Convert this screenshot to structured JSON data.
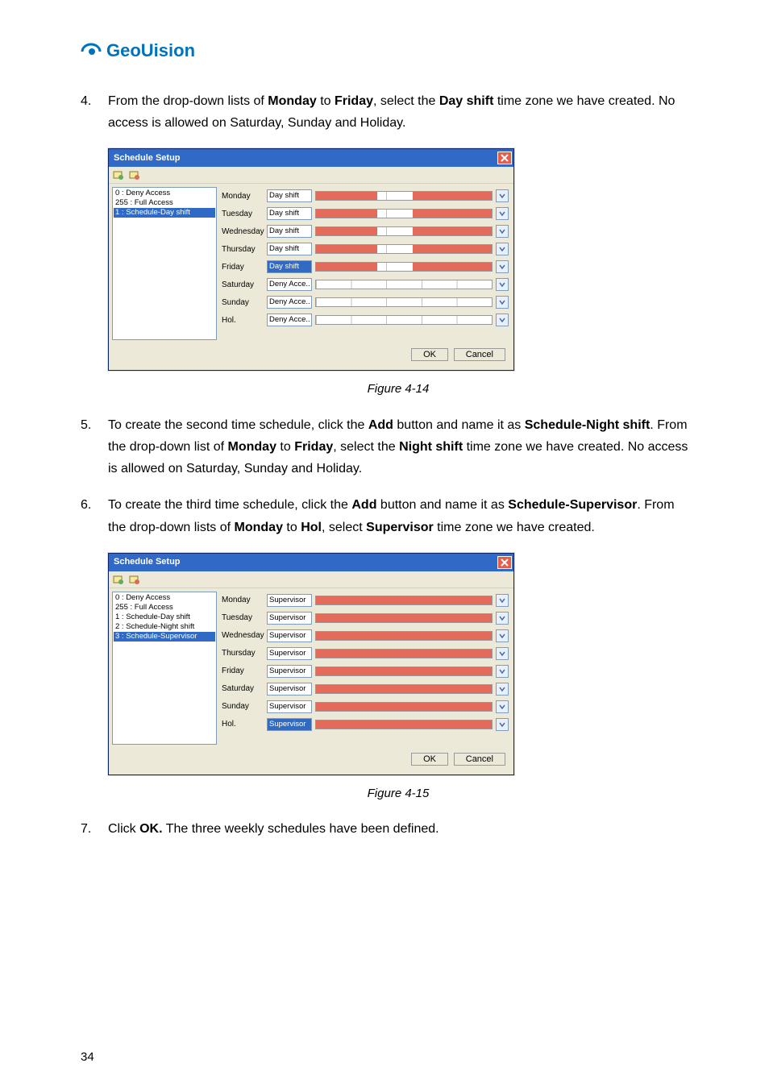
{
  "logo": {
    "text": "GeoUision"
  },
  "steps": [
    {
      "num": "4.",
      "html_parts": [
        "From the drop-down lists of ",
        {
          "b": "Monday"
        },
        " to ",
        {
          "b": "Friday"
        },
        ", select the ",
        {
          "b": "Day shift"
        },
        " time zone we have created. No access is allowed on Saturday, Sunday and Holiday."
      ]
    },
    {
      "num": "5.",
      "html_parts": [
        "To create the second time schedule, click the ",
        {
          "b": "Add"
        },
        " button and name it as ",
        {
          "b": "Schedule-Night shift"
        },
        ". From the drop-down list of ",
        {
          "b": "Monday"
        },
        " to ",
        {
          "b": "Friday"
        },
        ", select the ",
        {
          "b": "Night shift"
        },
        " time zone we have created. No access is allowed on Saturday, Sunday and Holiday."
      ]
    },
    {
      "num": "6.",
      "html_parts": [
        "To create the third time schedule, click the ",
        {
          "b": "Add"
        },
        " button and name it as ",
        {
          "b": "Schedule-Supervisor"
        },
        ". From the drop-down lists of ",
        {
          "b": "Monday"
        },
        " to ",
        {
          "b": "Hol"
        },
        ", select ",
        {
          "b": "Supervisor"
        },
        " time zone we have created."
      ]
    },
    {
      "num": "7.",
      "html_parts": [
        "Click ",
        {
          "b": "OK."
        },
        " The three weekly schedules have been defined."
      ]
    }
  ],
  "figure1_caption": "Figure 4-14",
  "figure2_caption": "Figure 4-15",
  "window_common": {
    "title": "Schedule Setup",
    "ok_label": "OK",
    "cancel_label": "Cancel"
  },
  "window1": {
    "list": [
      {
        "label": "0 : Deny Access",
        "selected": false
      },
      {
        "label": "255 : Full Access",
        "selected": false
      },
      {
        "label": "1 : Schedule-Day shift",
        "selected": true
      }
    ],
    "rows": [
      {
        "day": "Monday",
        "zone": "Day shift",
        "fill_segments": [
          [
            0,
            35
          ],
          [
            55,
            100
          ]
        ],
        "zone_selected": false
      },
      {
        "day": "Tuesday",
        "zone": "Day shift",
        "fill_segments": [
          [
            0,
            35
          ],
          [
            55,
            100
          ]
        ],
        "zone_selected": false
      },
      {
        "day": "Wednesday",
        "zone": "Day shift",
        "fill_segments": [
          [
            0,
            35
          ],
          [
            55,
            100
          ]
        ],
        "zone_selected": false
      },
      {
        "day": "Thursday",
        "zone": "Day shift",
        "fill_segments": [
          [
            0,
            35
          ],
          [
            55,
            100
          ]
        ],
        "zone_selected": false
      },
      {
        "day": "Friday",
        "zone": "Day shift",
        "fill_segments": [
          [
            0,
            35
          ],
          [
            55,
            100
          ]
        ],
        "zone_selected": true
      },
      {
        "day": "Saturday",
        "zone": "Deny Acce..",
        "fill_segments": [],
        "zone_selected": false
      },
      {
        "day": "Sunday",
        "zone": "Deny Acce..",
        "fill_segments": [],
        "zone_selected": false
      },
      {
        "day": "Hol.",
        "zone": "Deny Acce..",
        "fill_segments": [],
        "zone_selected": false
      }
    ]
  },
  "window2": {
    "list": [
      {
        "label": "0 : Deny Access",
        "selected": false
      },
      {
        "label": "255 : Full Access",
        "selected": false
      },
      {
        "label": "1 : Schedule-Day shift",
        "selected": false
      },
      {
        "label": "2 : Schedule-Night shift",
        "selected": false
      },
      {
        "label": "3 : Schedule-Supervisor",
        "selected": true
      }
    ],
    "rows": [
      {
        "day": "Monday",
        "zone": "Supervisor",
        "fill_segments": [
          [
            0,
            100
          ]
        ],
        "zone_selected": false
      },
      {
        "day": "Tuesday",
        "zone": "Supervisor",
        "fill_segments": [
          [
            0,
            100
          ]
        ],
        "zone_selected": false
      },
      {
        "day": "Wednesday",
        "zone": "Supervisor",
        "fill_segments": [
          [
            0,
            100
          ]
        ],
        "zone_selected": false
      },
      {
        "day": "Thursday",
        "zone": "Supervisor",
        "fill_segments": [
          [
            0,
            100
          ]
        ],
        "zone_selected": false
      },
      {
        "day": "Friday",
        "zone": "Supervisor",
        "fill_segments": [
          [
            0,
            100
          ]
        ],
        "zone_selected": false
      },
      {
        "day": "Saturday",
        "zone": "Supervisor",
        "fill_segments": [
          [
            0,
            100
          ]
        ],
        "zone_selected": false
      },
      {
        "day": "Sunday",
        "zone": "Supervisor",
        "fill_segments": [
          [
            0,
            100
          ]
        ],
        "zone_selected": false
      },
      {
        "day": "Hol.",
        "zone": "Supervisor",
        "fill_segments": [
          [
            0,
            100
          ]
        ],
        "zone_selected": true
      }
    ]
  },
  "page_number": "34"
}
